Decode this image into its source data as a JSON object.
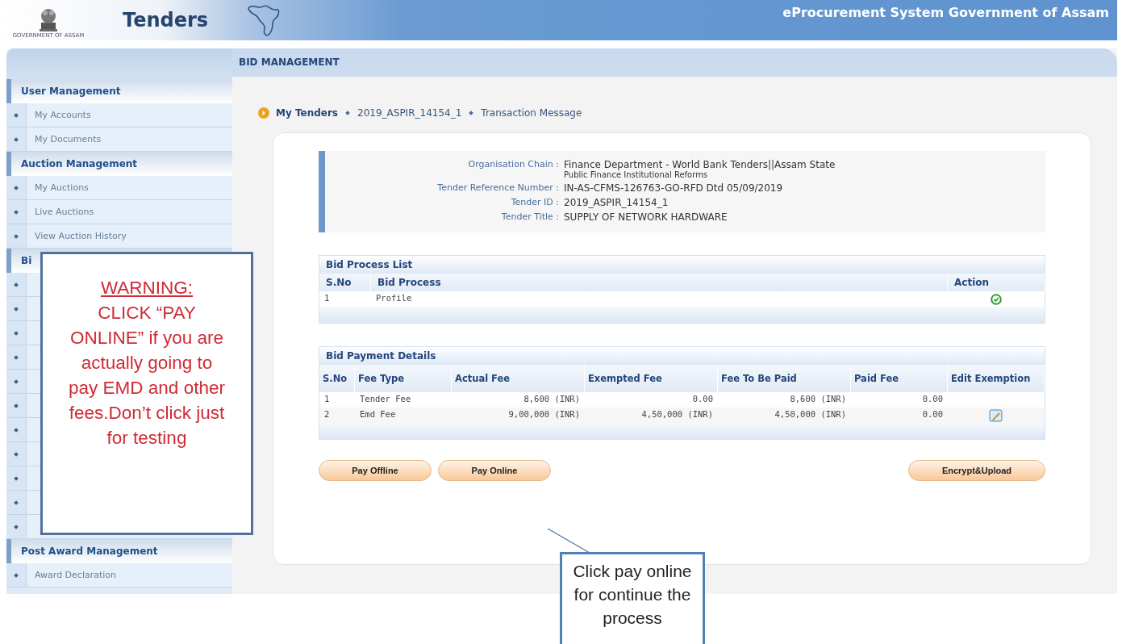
{
  "header": {
    "logo_caption": "GOVERNMENT OF ASSAM",
    "brand": "Tenders",
    "system_title": "eProcurement System Government of Assam"
  },
  "sidebar": {
    "sections": [
      {
        "title": "User Management",
        "items": [
          {
            "label": "My Accounts",
            "kind": "link"
          },
          {
            "label": "My Documents",
            "kind": "link"
          }
        ]
      },
      {
        "title": "Auction Management",
        "items": [
          {
            "label": "My Auctions",
            "kind": "link"
          },
          {
            "label": "Live Auctions",
            "kind": "link"
          },
          {
            "label": "View Auction History",
            "kind": "link"
          }
        ]
      },
      {
        "title": "Bi",
        "items": [
          {
            "kind": "covered"
          },
          {
            "kind": "covered"
          },
          {
            "kind": "covered"
          },
          {
            "kind": "covered"
          },
          {
            "kind": "covered"
          },
          {
            "kind": "covered"
          },
          {
            "kind": "covered"
          },
          {
            "kind": "covered"
          },
          {
            "kind": "covered"
          },
          {
            "kind": "covered"
          },
          {
            "kind": "covered"
          }
        ]
      },
      {
        "title": "Post Award Management",
        "items": [
          {
            "label": "Award Declaration",
            "kind": "link"
          }
        ]
      }
    ]
  },
  "page_title": "BID MANAGEMENT",
  "breadcrumb": [
    {
      "label": "My Tenders",
      "kind": "link"
    },
    {
      "label": "2019_ASPIR_14154_1",
      "kind": "text"
    },
    {
      "label": "Transaction Message",
      "kind": "text"
    }
  ],
  "tender_info": [
    {
      "label": "Organisation Chain :",
      "value": "Finance Department - World Bank Tenders||Assam State",
      "sub": "Public Finance Institutional Reforms"
    },
    {
      "label": "Tender Reference Number :",
      "value": "IN-AS-CFMS-126763-GO-RFD Dtd 05/09/2019"
    },
    {
      "label": "Tender ID :",
      "value": "2019_ASPIR_14154_1"
    },
    {
      "label": "Tender Title :",
      "value": "SUPPLY OF NETWORK HARDWARE"
    }
  ],
  "bid_process": {
    "title": "Bid Process List",
    "columns": [
      "S.No",
      "Bid Process",
      "Action"
    ],
    "rows": [
      {
        "sno": "1",
        "process": "Profile",
        "done": true
      }
    ]
  },
  "bid_payment": {
    "title": "Bid Payment Details",
    "columns": [
      "S.No",
      "Fee Type",
      "Actual Fee",
      "Exempted Fee",
      "Fee To Be Paid",
      "Paid Fee",
      "Edit Exemption"
    ],
    "rows": [
      {
        "cells": [
          "1",
          "Tender Fee",
          "8,600 (INR)",
          "0.00",
          "8,600 (INR)",
          "0.00"
        ],
        "editable": false
      },
      {
        "cells": [
          "2",
          "Emd Fee",
          "9,00,000 (INR)",
          "4,50,000 (INR)",
          "4,50,000 (INR)",
          "0.00"
        ],
        "editable": true
      }
    ]
  },
  "buttons": [
    {
      "label": "Pay Offline"
    },
    {
      "label": "Pay Online"
    },
    {
      "label": "Encrypt&Upload"
    }
  ],
  "warning_callout": {
    "heading": "WARNING:",
    "text": "CLICK “PAY ONLINE” if you are actually going to pay EMD and other fees.Don’t click just for testing"
  },
  "pointer_callout": {
    "text": "Click pay online for continue the process"
  }
}
